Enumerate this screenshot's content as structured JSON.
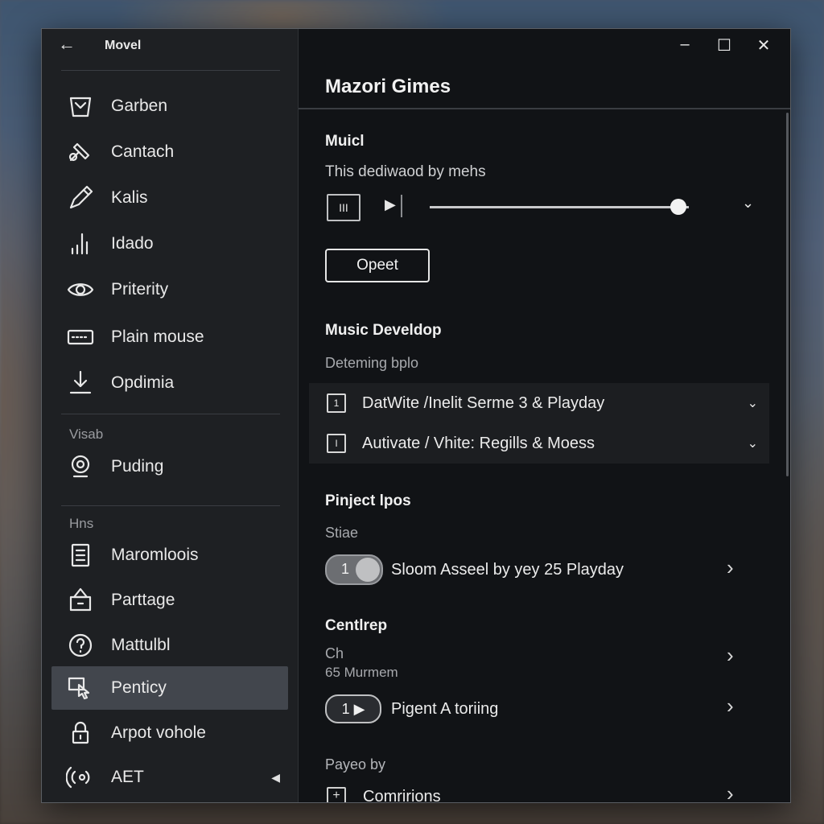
{
  "sidebar": {
    "back_icon": "←",
    "title": "Movel",
    "items_a": [
      {
        "label": "Garben",
        "icon": "basket-icon"
      },
      {
        "label": "Cantach",
        "icon": "tools-icon"
      },
      {
        "label": "Kalis",
        "icon": "pencil-icon"
      },
      {
        "label": "Idado",
        "icon": "bars-icon"
      },
      {
        "label": "Priterity",
        "icon": "eye-icon"
      },
      {
        "label": "Plain mouse",
        "icon": "keyboard-icon"
      },
      {
        "label": "Opdimia",
        "icon": "download-icon"
      }
    ],
    "section_visab": "Visab",
    "items_b": [
      {
        "label": "Puding",
        "icon": "webcam-icon"
      }
    ],
    "section_hns": "Hns",
    "items_c": [
      {
        "label": "Maromloois",
        "icon": "document-icon"
      },
      {
        "label": "Parttage",
        "icon": "package-icon"
      },
      {
        "label": "Mattulbl",
        "icon": "help-circle-icon"
      },
      {
        "label": "Penticy",
        "icon": "pointer-hand-icon"
      },
      {
        "label": "Arpot vohole",
        "icon": "lock-icon"
      },
      {
        "label": "AET",
        "icon": "audio-signal-icon"
      }
    ],
    "active": "Penticy",
    "aet_caret": "◀"
  },
  "window_controls": {
    "minimize": "–",
    "maximize": "☐",
    "close": "✕"
  },
  "main": {
    "title": "Mazori Gimes",
    "music": {
      "heading": "Muicl",
      "desc": "This dediwaod by mehs",
      "pause_label": "III",
      "play_label": "▶",
      "progress": 0.96,
      "dropdown_chevron": "⌄",
      "open_button": "Opeet"
    },
    "develop": {
      "heading": "Music Develdop",
      "sub": "Deteming bplo",
      "rows": [
        {
          "mark": "1",
          "text": "DatWite /Inelit Serme 3 & Playday",
          "chevron": "⌄"
        },
        {
          "mark": "I",
          "text": "Autivate / Vhite: Regills & Moess",
          "chevron": "⌄"
        }
      ]
    },
    "project": {
      "heading": "Pinject lpos",
      "sub": "Stiae",
      "toggle_value": "1",
      "row_text": "Sloom Asseel by yey 25 Playday",
      "arrow": "›"
    },
    "centrep": {
      "heading": "Centlrep",
      "line1": "Ch",
      "line2": "65 Murmem",
      "arrow1": "›",
      "pill_label": "1 ▶",
      "row_text": "Pigent A toriing",
      "arrow2": "›"
    },
    "payeo": {
      "heading": "Payeo by",
      "row_text": "Comririons",
      "arrow": "›"
    }
  }
}
